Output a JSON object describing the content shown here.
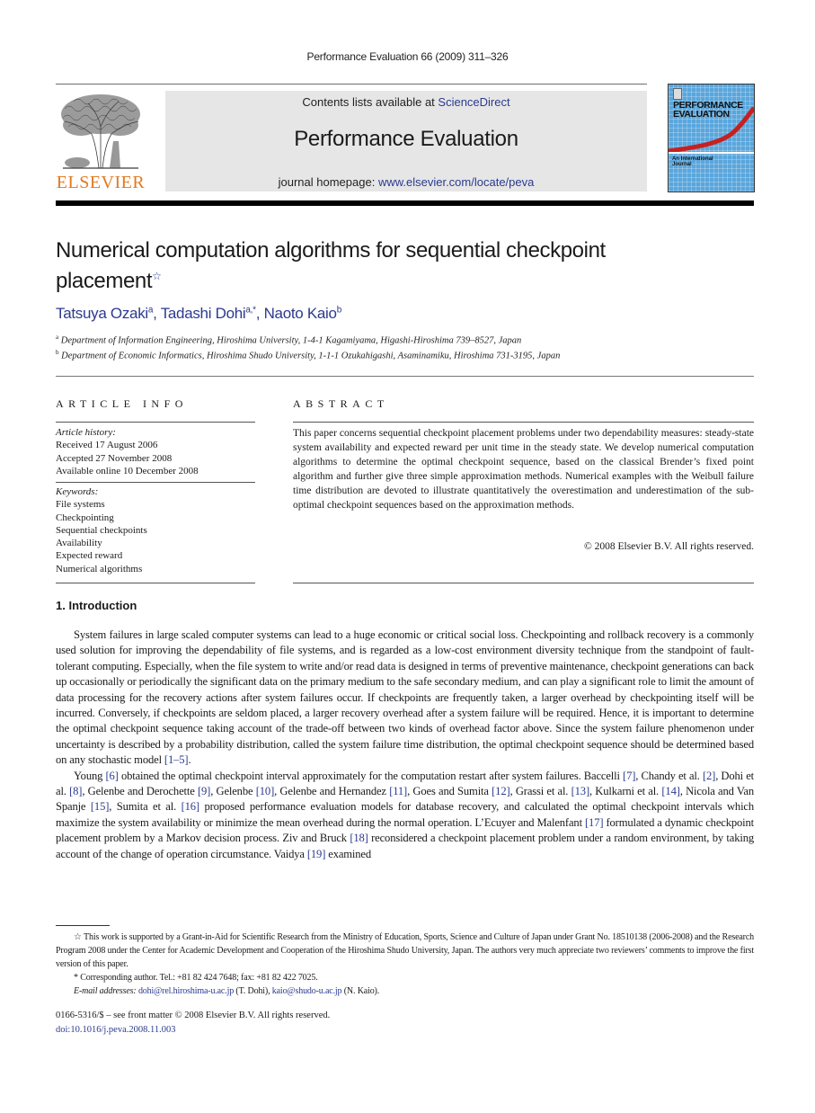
{
  "running_head": "Performance Evaluation 66 (2009) 311–326",
  "header": {
    "publisher_logo_text": "ELSEVIER",
    "contents_prefix": "Contents lists available at ",
    "contents_link": "ScienceDirect",
    "journal_title": "Performance Evaluation",
    "homepage_prefix": "journal homepage: ",
    "homepage_link": "www.elsevier.com/locate/peva",
    "cover": {
      "title_line1": "PERFORMANCE",
      "title_line2": "EVALUATION",
      "subtitle_line1": "An International",
      "subtitle_line2": "Journal"
    }
  },
  "article": {
    "title_line1": "Numerical computation algorithms for sequential checkpoint",
    "title_line2": "placement",
    "title_mark": "☆",
    "authors": [
      {
        "name": "Tatsuya Ozaki",
        "sup": "a"
      },
      {
        "name": "Tadashi Dohi",
        "sup": "a,*"
      },
      {
        "name": "Naoto Kaio",
        "sup": "b"
      }
    ],
    "affiliations": [
      {
        "mark": "a",
        "text": "Department of Information Engineering, Hiroshima University, 1-4-1 Kagamiyama, Higashi-Hiroshima 739–8527, Japan"
      },
      {
        "mark": "b",
        "text": "Department of Economic Informatics, Hiroshima Shudo University, 1-1-1 Ozukahigashi, Asaminamiku, Hiroshima 731-3195, Japan"
      }
    ]
  },
  "article_info": {
    "heading": "ARTICLE INFO",
    "history_label": "Article history:",
    "history": [
      "Received 17 August 2006",
      "Accepted 27 November 2008",
      "Available online 10 December 2008"
    ],
    "keywords_label": "Keywords:",
    "keywords": [
      "File systems",
      "Checkpointing",
      "Sequential checkpoints",
      "Availability",
      "Expected reward",
      "Numerical algorithms"
    ]
  },
  "abstract": {
    "heading": "ABSTRACT",
    "text": "This paper concerns sequential checkpoint placement problems under two dependability measures: steady-state system availability and expected reward per unit time in the steady state. We develop numerical computation algorithms to determine the optimal checkpoint sequence, based on the classical Brender’s fixed point algorithm and further give three simple approximation methods. Numerical examples with the Weibull failure time distribution are devoted to illustrate quantitatively the overestimation and underestimation of the sub-optimal checkpoint sequences based on the approximation methods.",
    "copyright": "© 2008 Elsevier B.V. All rights reserved."
  },
  "section": {
    "heading": "1.  Introduction",
    "p1_text": "System failures in large scaled computer systems can lead to a huge economic or critical social loss. Checkpointing and rollback recovery is a commonly used solution for improving the dependability of file systems, and is regarded as a low-cost environment diversity technique from the standpoint of fault-tolerant computing. Especially, when the file system to write and/or read data is designed in terms of preventive maintenance, checkpoint generations can back up occasionally or periodically the significant data on the primary medium to the safe secondary medium, and can play a significant role to limit the amount of data processing for the recovery actions after system failures occur. If checkpoints are frequently taken, a larger overhead by checkpointing itself will be incurred. Conversely, if checkpoints are seldom placed, a larger recovery overhead after a system failure will be required. Hence, it is important to determine the optimal checkpoint sequence taking account of the trade-off between two kinds of overhead factor above. Since the system failure phenomenon under uncertainty is described by a probability distribution, called the system failure time distribution, the optimal checkpoint sequence should be determined based on any stochastic model ",
    "p1_ref": "[1–5]",
    "p1_end": ".",
    "p2": [
      {
        "t": "Young "
      },
      {
        "r": "[6]"
      },
      {
        "t": " obtained the optimal checkpoint interval approximately for the computation restart after system failures. Baccelli "
      },
      {
        "r": "[7]"
      },
      {
        "t": ", Chandy et al. "
      },
      {
        "r": "[2]"
      },
      {
        "t": ", Dohi et al. "
      },
      {
        "r": "[8]"
      },
      {
        "t": ", Gelenbe and Derochette "
      },
      {
        "r": "[9]"
      },
      {
        "t": ", Gelenbe "
      },
      {
        "r": "[10]"
      },
      {
        "t": ", Gelenbe and Hernandez "
      },
      {
        "r": "[11]"
      },
      {
        "t": ", Goes and Sumita "
      },
      {
        "r": "[12]"
      },
      {
        "t": ", Grassi et al. "
      },
      {
        "r": "[13]"
      },
      {
        "t": ", Kulkarni et al. "
      },
      {
        "r": "[14]"
      },
      {
        "t": ", Nicola and Van Spanje "
      },
      {
        "r": "[15]"
      },
      {
        "t": ", Sumita et al. "
      },
      {
        "r": "[16]"
      },
      {
        "t": " proposed performance evaluation models for database recovery, and calculated the optimal checkpoint intervals which maximize the system availability or minimize the mean overhead during the normal operation. L’Ecuyer and Malenfant "
      },
      {
        "r": "[17]"
      },
      {
        "t": " formulated a dynamic checkpoint placement problem by a Markov decision process. Ziv and Bruck "
      },
      {
        "r": "[18]"
      },
      {
        "t": " reconsidered a checkpoint placement problem under a random environment, by taking account of the change of operation circumstance. Vaidya "
      },
      {
        "r": "[19]"
      },
      {
        "t": " examined"
      }
    ]
  },
  "footnotes": {
    "star_mark": "☆",
    "star_text": "This work is supported by a Grant-in-Aid for Scientific Research from the Ministry of Education, Sports, Science and Culture of Japan under Grant No. 18510138 (2006-2008) and the Research Program 2008 under the Center for Academic Development and Cooperation of the Hiroshima Shudo University, Japan. The authors very much appreciate two reviewers’ comments to improve the first version of this paper.",
    "corr_mark": "*",
    "corr_text": "Corresponding author. Tel.: +81 82 424 7648; fax: +81 82 422 7025.",
    "email_label": "E-mail addresses:",
    "email1": "dohi@rel.hiroshima-u.ac.jp",
    "email1_owner": " (T. Dohi), ",
    "email2": "kaio@shudo-u.ac.jp",
    "email2_owner": " (N. Kaio)."
  },
  "front_matter": {
    "issn": "0166-5316/$ – see front matter © 2008 Elsevier B.V. All rights reserved.",
    "doi": "doi:10.1016/j.peva.2008.11.003"
  },
  "colors": {
    "link": "#2b3a8f",
    "elsevier_orange": "#e3791f",
    "banner_gray": "#e6e6e6",
    "cover_blue": "#5aa6dc",
    "cover_red": "#c8201e"
  }
}
